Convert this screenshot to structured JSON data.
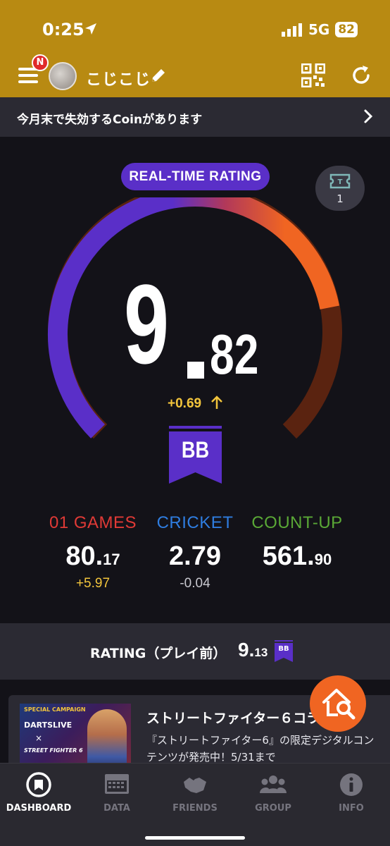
{
  "status_bar": {
    "time": "0:25",
    "network": "5G",
    "battery": "82"
  },
  "header": {
    "badge": "N",
    "username": "こじこじ"
  },
  "banner": {
    "text": "今月末で失効するCoinがあります"
  },
  "realtime": {
    "label": "REAL-TIME RATING",
    "ticket_count": "1",
    "rating_int": "9",
    "rating_dec": "82",
    "rating_value": 9.82,
    "diff": "+0.69",
    "class": "BB",
    "colors": {
      "purple": "#5a2fc8",
      "orange": "#f06522",
      "dark_orange": "#5a2310",
      "yellow": "#f3c53c"
    }
  },
  "stats": [
    {
      "label": "01 GAMES",
      "int": "80.",
      "dec": "17",
      "diff": "+5.97",
      "label_color": "#e03a36",
      "diff_color": "#f3c53c"
    },
    {
      "label": "CRICKET",
      "int": "2.79",
      "dec": "",
      "diff": "-0.04",
      "label_color": "#2f7de0",
      "diff_color": "#c8c8cf"
    },
    {
      "label": "COUNT-UP",
      "int": "561.",
      "dec": "90",
      "diff": "",
      "label_color": "#5aa836",
      "diff_color": "#c8c8cf"
    }
  ],
  "rating_bar": {
    "label": "RATING（プレイ前）",
    "int": "9.",
    "dec": "13",
    "class": "BB"
  },
  "promo": {
    "image_tag": "SPECIAL CAMPAIGN",
    "image_brand": "DARTSLIVE",
    "image_x": "×",
    "image_game": "STREET FIGHTER 6",
    "title": "ストリートファイター６コラ",
    "description": "『ストリートファイター6』の限定デジタルコンテンツが発売中！5/31まで"
  },
  "tabs": [
    {
      "label": "DASHBOARD",
      "icon": "dashboard-icon",
      "active": true
    },
    {
      "label": "DATA",
      "icon": "data-icon",
      "active": false
    },
    {
      "label": "FRIENDS",
      "icon": "friends-icon",
      "active": false
    },
    {
      "label": "GROUP",
      "icon": "group-icon",
      "active": false
    },
    {
      "label": "INFO",
      "icon": "info-icon",
      "active": false
    }
  ]
}
